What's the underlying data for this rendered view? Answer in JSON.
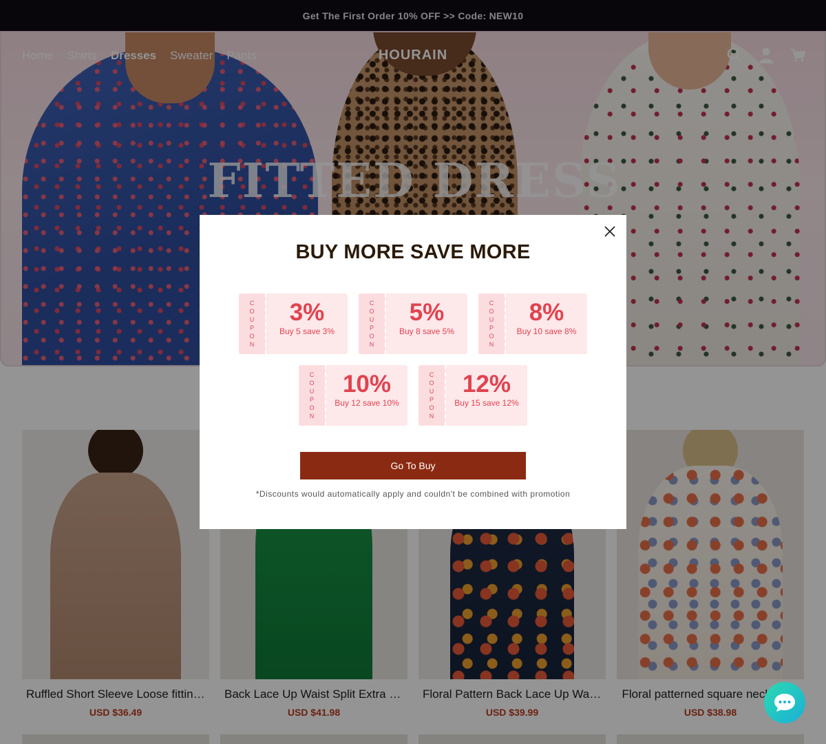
{
  "announcement": "Get The First Order 10% OFF >> Code: NEW10",
  "nav": {
    "links": [
      "Home",
      "Shirts",
      "Dresses",
      "Sweater",
      "Pants"
    ],
    "active": "Dresses",
    "logo": "HOURAIN",
    "icons": [
      "search-icon",
      "account-icon",
      "cart-icon"
    ]
  },
  "hero": {
    "title": "FITTED DRESS"
  },
  "products": [
    {
      "name": "Ruffled Short Sleeve Loose fitting...",
      "price": "USD $36.49"
    },
    {
      "name": "Back Lace Up Waist Split Extra Long...",
      "price": "USD $41.98"
    },
    {
      "name": "Floral Pattern Back Lace Up Waist...",
      "price": "USD $39.99"
    },
    {
      "name": "Floral patterned square neckline...",
      "price": "USD $38.98"
    }
  ],
  "modal": {
    "title": "BUY MORE SAVE MORE",
    "coupon_stub": "COUPON",
    "coupons": [
      {
        "percent": "3%",
        "desc": "Buy 5 save 3%"
      },
      {
        "percent": "5%",
        "desc": "Buy 8 save 5%"
      },
      {
        "percent": "8%",
        "desc": "Buy 10 save 8%"
      },
      {
        "percent": "10%",
        "desc": "Buy 12 save 10%"
      },
      {
        "percent": "12%",
        "desc": "Buy 15 save 12%"
      }
    ],
    "button": "Go To Buy",
    "note": "*Discounts would automatically apply and couldn't be combined with promotion"
  },
  "colors": {
    "accent": "#8b2a12",
    "coupon": "#e0434f",
    "price": "#b83a1e",
    "chat": "#1bb0d6"
  }
}
